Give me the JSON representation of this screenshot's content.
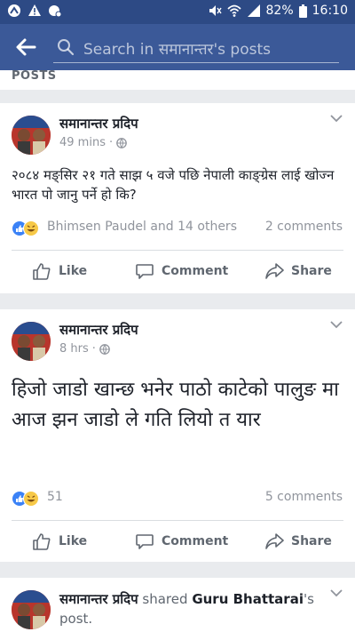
{
  "status_bar": {
    "battery": "82%",
    "time": "16:10"
  },
  "search": {
    "placeholder": "Search in समानान्तर's posts"
  },
  "section": {
    "label": "POSTS"
  },
  "actions": {
    "like": "Like",
    "comment": "Comment",
    "share": "Share"
  },
  "posts": [
    {
      "author": "समानान्तर प्रदिप",
      "time": "49 mins",
      "text": "२०८४ मङ्सिर २१ गते साझ ५ वजे पछि नेपाली काङ्ग्रेस लाई खोज्न भारत पो जानु पर्ने हो कि?",
      "reactions": "Bhimsen Paudel and 14 others",
      "comments": "2 comments"
    },
    {
      "author": "समानान्तर प्रदिप",
      "time": "8 hrs",
      "text": "हिजो जाडो खान्छ भनेर पाठो काटेको पालुङ मा आज झन जाडो ले गति लियो त यार",
      "reactions": "51",
      "comments": "5 comments"
    },
    {
      "author": "समानान्तर प्रदिप",
      "shared_text": "shared",
      "shared_author": "Guru Bhattarai",
      "shared_suffix": "'s post."
    }
  ]
}
